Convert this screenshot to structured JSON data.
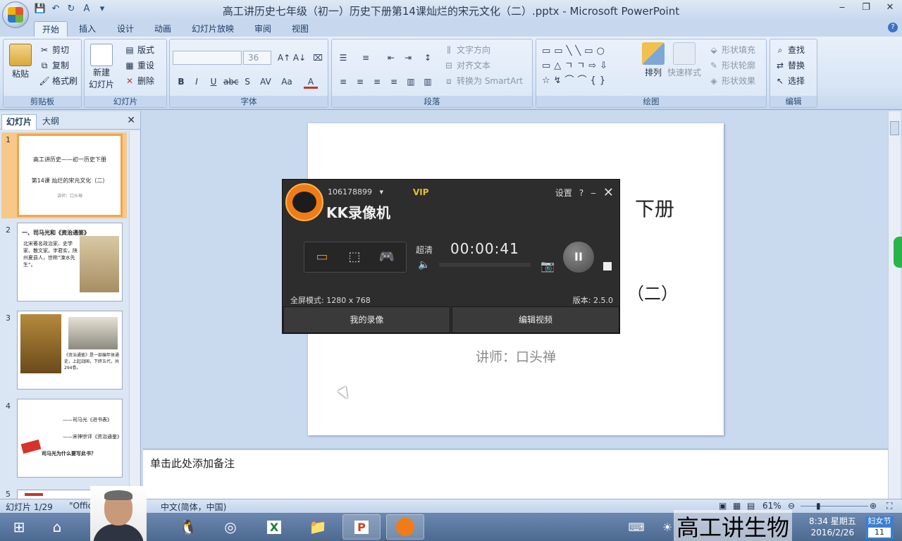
{
  "window": {
    "title": "高工讲历史七年级（初一）历史下册第14课灿烂的宋元文化（二）.pptx - Microsoft PowerPoint",
    "controls": [
      "‒",
      "❐",
      "✕"
    ]
  },
  "ribbon_tabs": [
    "开始",
    "插入",
    "设计",
    "动画",
    "幻灯片放映",
    "审阅",
    "视图"
  ],
  "ribbon": {
    "clipboard": {
      "label": "剪贴板",
      "paste": "粘贴",
      "cut": "剪切",
      "copy": "复制",
      "format_painter": "格式刷"
    },
    "slides": {
      "label": "幻灯片",
      "new_slide": "新建",
      "new_slide2": "幻灯片",
      "layout": "版式",
      "reset": "重设",
      "delete": "删除"
    },
    "font": {
      "label": "字体",
      "font_size": "36",
      "buttons": [
        "B",
        "I",
        "U",
        "abc",
        "S",
        "AV",
        "Aa",
        "A"
      ]
    },
    "paragraph": {
      "label": "段落",
      "text_direction": "文字方向",
      "align_text": "对齐文本",
      "convert_smartart": "转换为 SmartArt"
    },
    "drawing": {
      "label": "绘图",
      "arrange": "排列",
      "quick_styles": "快速样式",
      "shape_fill": "形状填充",
      "shape_outline": "形状轮廓",
      "shape_effects": "形状效果"
    },
    "editing": {
      "label": "编辑",
      "find": "查找",
      "replace": "替换",
      "select": "选择"
    }
  },
  "left_panel": {
    "tabs": [
      "幻灯片",
      "大纲"
    ],
    "slides": [
      {
        "num": "1",
        "lines": [
          "高工讲历史——初一历史下册",
          "第14课 灿烂的宋元文化（二）",
          "讲师：口头禅"
        ]
      },
      {
        "num": "2",
        "lines": [
          "一、司马光和《资治通鉴》",
          "北宋著名政治家、史学家、散文家。字君实，陕州夏县人，世称“涑水先生”。"
        ]
      },
      {
        "num": "3",
        "lines": [
          "《资治通鉴》是一部编年体通史，上起战国，下终五代，共294卷。"
        ]
      },
      {
        "num": "4",
        "lines": [
          "——司马光《进书表》",
          "——宋神宗评《资治通鉴》",
          "司马光为什么要写此书？"
        ]
      },
      {
        "num": "5",
        "lines": [
          ""
        ]
      }
    ]
  },
  "slide": {
    "title_fragment": "下册",
    "subtitle_fragment": "（二）",
    "teacher": "讲师：口头禅"
  },
  "notes_placeholder": "单击此处添加备注",
  "statusbar": {
    "slide_info": "幻灯片 1/29",
    "theme": "\"Offic",
    "language": "中文(简体，中国)",
    "zoom": "61%"
  },
  "recorder": {
    "account_id": "106178899",
    "vip": "VIP",
    "app_name": "KK录像机",
    "settings": "设置",
    "help": "?",
    "minimize": "‒",
    "close": "✕",
    "quality": "超清",
    "time": "00:00:41",
    "fullscreen_mode": "全屏模式: 1280 x 768",
    "version": "版本: 2.5.0",
    "my_recordings": "我的录像",
    "edit_video": "编辑视频"
  },
  "taskbar": {
    "overlay_text": "高工讲生物",
    "time": "8:34 星期五",
    "date": "2016/2/26",
    "badge_title": "妇女节",
    "badge_num": "11"
  },
  "colors": {
    "accent": "#2b4f82",
    "recorder_bg": "#2d2d2d",
    "recorder_orange": "#f07c18",
    "vip_gold": "#e3c02c",
    "selected_thumb": "#f2a54a"
  }
}
